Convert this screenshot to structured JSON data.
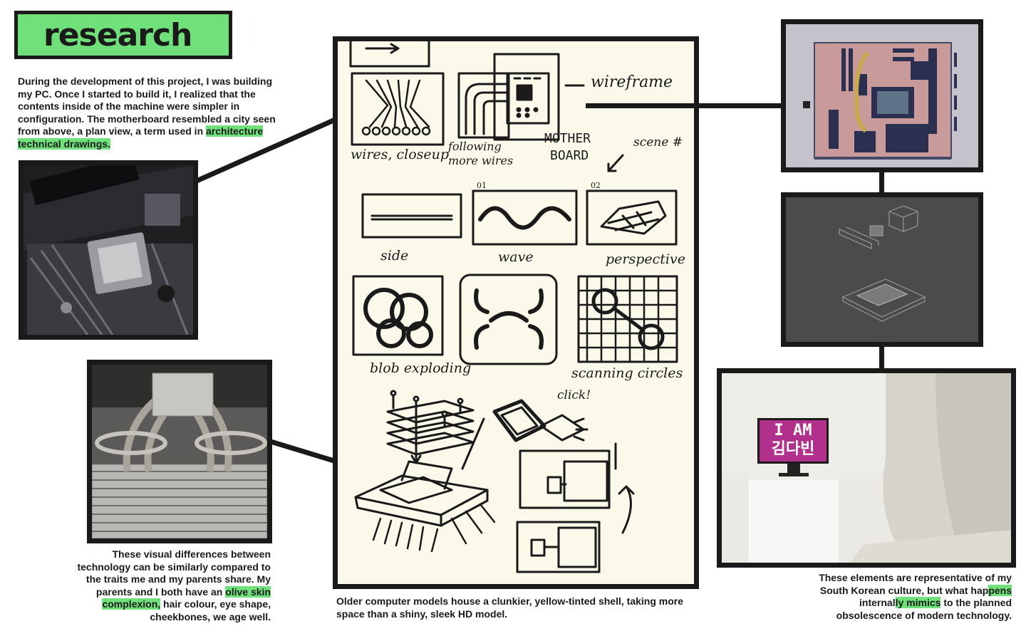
{
  "title": "research",
  "intro": {
    "text": "During the development of this project, I was building my PC. Once I started to build it, I realized that the contents inside of the machine were simpler in configuration. The motherboard resembled a city seen from above, a plan view, a term used in",
    "highlight": "architecture technical drawings."
  },
  "cooler_caption": {
    "text_before": "These visual differences between technology can be similarly compared to the traits me and my parents share. My parents and I both have an",
    "highlight1": "olive skin",
    "highlight2": "complexion,",
    "text_after": "hair colour, eye shape, cheekbones, we age well."
  },
  "sketch_caption": "Older computer models house a clunkier, yellow-tinted shell, taking more space than a shiny, sleek HD model.",
  "right_caption": {
    "part1": "These elements are representative of my South Korean culture, but what hap",
    "hl1": "pens",
    "part2": "internal",
    "hl2": "ly mimics",
    "part3": "to the planned obsolescence of modern technology."
  },
  "sketch_labels": {
    "wireframe": "wireframe",
    "wires": "wires, closeup",
    "following": "following more wires",
    "mother": "MOTHER",
    "board": "BOARD",
    "scene": "scene #",
    "num1": "01",
    "num2": "02",
    "side": "side",
    "wave": "wave",
    "perspective": "perspective",
    "blob": "blob exploding",
    "scanning": "scanning circles",
    "click": "click!"
  },
  "monitor_screen": {
    "line1": "I AM",
    "line2": "김다빈"
  },
  "colors": {
    "highlight": "#6fe07a",
    "frame": "#1a1a1a",
    "render_bg": "#c9c6cf",
    "pcb": "#c99a9a",
    "dark_render_bg": "#4a4a4a",
    "screen_magenta": "#b0308c"
  }
}
